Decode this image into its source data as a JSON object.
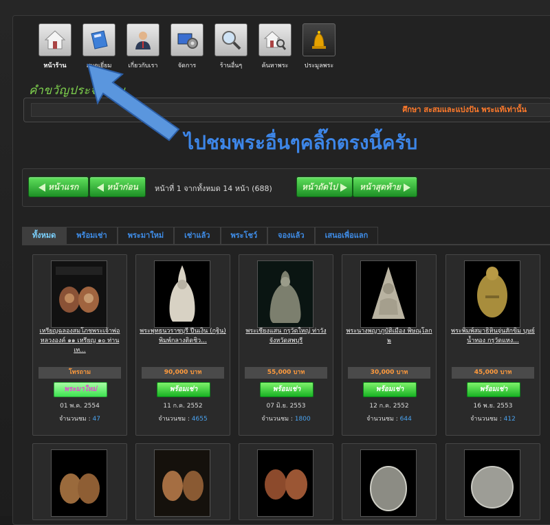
{
  "nav": {
    "items": [
      {
        "label": "หน้าร้าน",
        "icon": "home-icon",
        "active": true
      },
      {
        "label": "สมุดเยี่ยม",
        "icon": "book-icon",
        "active": false
      },
      {
        "label": "เกี่ยวกับเรา",
        "icon": "user-icon",
        "active": false
      },
      {
        "label": "จัดการ",
        "icon": "settings-icon",
        "active": false
      },
      {
        "label": "ร้านอื่นๆ",
        "icon": "magnifier-icon",
        "active": false
      },
      {
        "label": "ค้นหาพระ",
        "icon": "house-search-icon",
        "active": false
      },
      {
        "label": "ประมูลพระ",
        "icon": "bell-icon",
        "active": false
      }
    ]
  },
  "welcome": {
    "title": "คำขวัญประจำร้าน",
    "marquee": "ศึกษา สะสมและแบ่งปัน พระแท้เท่านั้น"
  },
  "annotation": {
    "text": "ไปชมพระอื่นๆคลิ๊กตรงนี้ครับ",
    "color": "#3d86e8"
  },
  "pager": {
    "first": "หน้าแรก",
    "prev": "หน้าก่อน",
    "info": "หน้าที่ 1 จากทั้งหมด 14 หน้า (688)",
    "next": "หน้าถัดไป",
    "last": "หน้าสุดท้าย"
  },
  "tabs": [
    "ทั้งหมด",
    "พร้อมเช่า",
    "พระมาใหม่",
    "เช่าแล้ว",
    "พระโชว์",
    "จองแล้ว",
    "เสนอเพื่อแลก"
  ],
  "items": [
    {
      "title": "เหรียญฉลองสมโภชพระเจ้าพ่อหลวงองค์ ๑๑ เหรียญ ๑๐ ท่านเท...",
      "price": "โทรถาม",
      "status": "พระมาใหม่",
      "date": "01 พ.ค. 2554",
      "views_label": "จำนวนชม :",
      "views": "47"
    },
    {
      "title": "พระพุทธนวราชบุรี ปีนเงิน (กฐิน) พิมพ์กลางติดชิว...",
      "price": "90,000 บาท",
      "status": "พร้อมเช่า",
      "date": "11 ก.ค. 2552",
      "views_label": "จำนวนชม :",
      "views": "4655"
    },
    {
      "title": "พระเชียงแสน กรุวัดใหญ่ ท่าวัง จังหวัดสพบุรี",
      "price": "55,000 บาท",
      "status": "พร้อมเช่า",
      "date": "07 มิ.ย. 2553",
      "views_label": "จำนวนชม :",
      "views": "1800"
    },
    {
      "title": "พระนางพญาภูบัติเมือง พิษณุโลก ๒",
      "price": "30,000 บาท",
      "status": "พร้อมเช่า",
      "date": "12 ก.ค. 2552",
      "views_label": "จำนวนชม :",
      "views": "644"
    },
    {
      "title": "พระพิมพ์สมาธิหินจุ่นสักขิม บุษย์น้ำทอง กรุวัดแหง...",
      "price": "45,000 บาท",
      "status": "พร้อมเช่า",
      "date": "16 พ.ย. 2553",
      "views_label": "จำนวนชม :",
      "views": "412"
    }
  ]
}
